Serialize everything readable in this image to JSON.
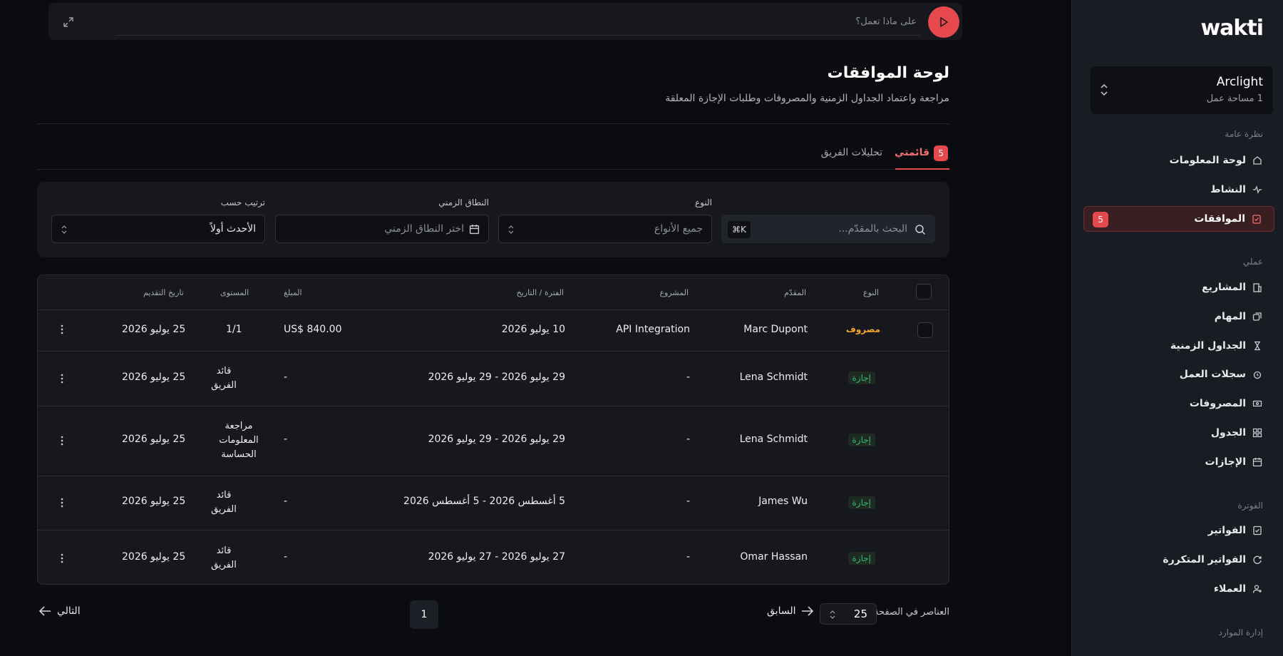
{
  "app": {
    "logo": "wakti"
  },
  "workspace": {
    "name": "Arclight",
    "subtitle": "1 مساحة عمل"
  },
  "sidebar": {
    "sections": [
      {
        "label": "نظرة عامة"
      },
      {
        "label": "عملي"
      },
      {
        "label": "الفوترة"
      },
      {
        "label": "إدارة الموارد"
      }
    ],
    "items": [
      {
        "label": "لوحة المعلومات",
        "icon": "home-icon"
      },
      {
        "label": "النشاط",
        "icon": "activity-icon"
      },
      {
        "label": "الموافقات",
        "icon": "approval-icon",
        "badge": "5",
        "active": true
      },
      {
        "label": "المشاريع",
        "icon": "building-icon"
      },
      {
        "label": "المهام",
        "icon": "tasks-icon"
      },
      {
        "label": "الجداول الزمنية",
        "icon": "hourglass-icon"
      },
      {
        "label": "سجلات العمل",
        "icon": "alarm-icon"
      },
      {
        "label": "المصروفات",
        "icon": "banknote-icon"
      },
      {
        "label": "الجدول",
        "icon": "grid-icon"
      },
      {
        "label": "الإجازات",
        "icon": "calendar-icon"
      },
      {
        "label": "الفواتير",
        "icon": "invoice-check-icon"
      },
      {
        "label": "الفواتير المتكررة",
        "icon": "recurring-icon"
      },
      {
        "label": "العملاء",
        "icon": "user-plus-icon"
      }
    ]
  },
  "command_bar": {
    "placeholder": "على ماذا تعمل؟"
  },
  "page": {
    "title": "لوحة الموافقات",
    "subtitle": "مراجعة واعتماد الجداول الزمنية والمصروفات وطلبات الإجازة المعلقة"
  },
  "tabs": {
    "mine": {
      "label": "قائمتي",
      "badge": "5"
    },
    "team": {
      "label": "تحليلات الفريق"
    }
  },
  "filters": {
    "search": {
      "placeholder": "البحث بالمقدّم...",
      "shortcut": "⌘K"
    },
    "type": {
      "label": "النوع",
      "placeholder": "جميع الأنواع"
    },
    "date_range": {
      "label": "النطاق الزمني",
      "placeholder": "اختر النطاق الزمني"
    },
    "sort": {
      "label": "ترتيب حسب",
      "value": "الأحدث أولاً"
    }
  },
  "table": {
    "headers": {
      "type": "النوع",
      "submitter": "المقدّم",
      "project": "المشروع",
      "period": "الفترة / التاريخ",
      "amount": "المبلغ",
      "level": "المستوى",
      "submitted": "تاريخ التقديم"
    },
    "rows": [
      {
        "type": "مصروف",
        "submitter": "Marc Dupont",
        "project": "API Integration",
        "period": "10 يوليو 2026",
        "amount": "US$ 840.00",
        "level": "1/1",
        "submitted": "25 يوليو 2026"
      },
      {
        "type": "إجازة",
        "submitter": "Lena Schmidt",
        "project": "-",
        "period": "29 يوليو 2026 - 29 يوليو 2026",
        "amount": "-",
        "level": "قائد الفريق",
        "submitted": "25 يوليو 2026"
      },
      {
        "type": "إجازة",
        "submitter": "Lena Schmidt",
        "project": "-",
        "period": "29 يوليو 2026 - 29 يوليو 2026",
        "amount": "-",
        "level": "مراجعة المعلومات الحساسة",
        "submitted": "25 يوليو 2026"
      },
      {
        "type": "إجازة",
        "submitter": "James Wu",
        "project": "-",
        "period": "5 أغسطس 2026 - 5 أغسطس 2026",
        "amount": "-",
        "level": "قائد الفريق",
        "submitted": "25 يوليو 2026"
      },
      {
        "type": "إجازة",
        "submitter": "Omar Hassan",
        "project": "-",
        "period": "27 يوليو 2026 - 27 يوليو 2026",
        "amount": "-",
        "level": "قائد الفريق",
        "submitted": "25 يوليو 2026"
      }
    ]
  },
  "pagination": {
    "per_page_label": "العناصر في الصفحة",
    "per_page": "25",
    "prev": "السابق",
    "page": "1",
    "next": "التالي"
  },
  "colors": {
    "accent": "#e5484d",
    "expense": "#f5a524",
    "leave": "#2fbf71"
  }
}
